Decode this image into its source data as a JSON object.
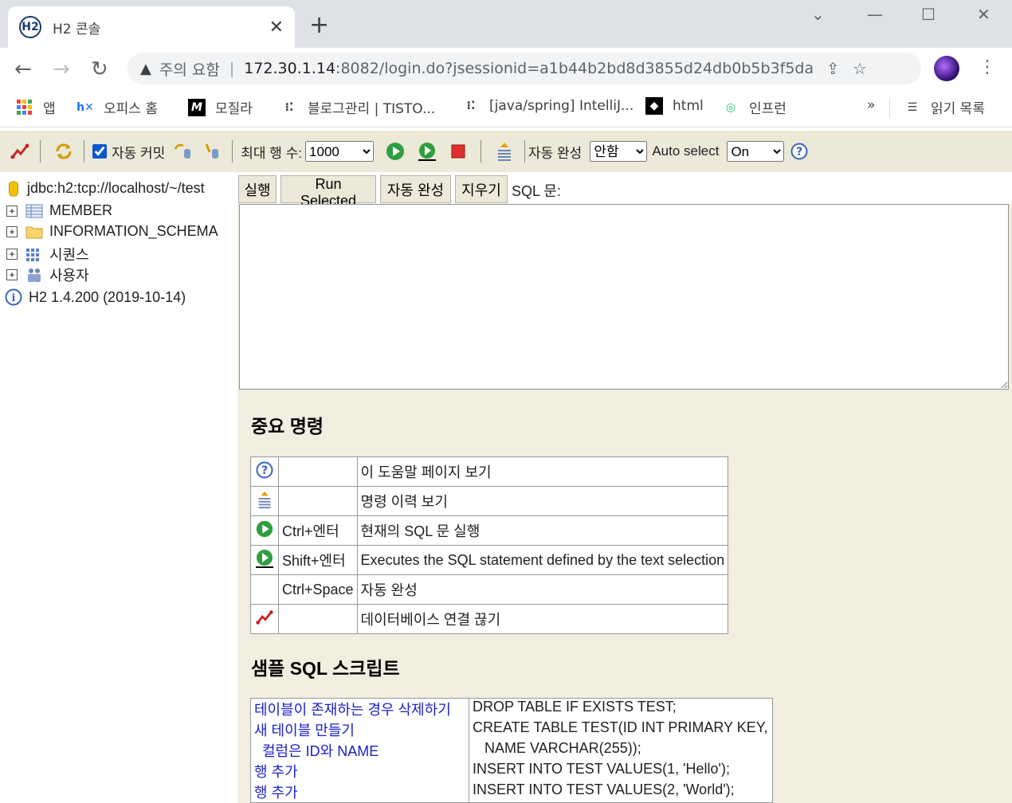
{
  "browser": {
    "tab_favicon": "H2",
    "tab_title": "H2 콘솔",
    "url_warning": "주의 요함",
    "url_host": "172.30.1.14",
    "url_path": ":8082/login.do?jsessionid=a1b44b2bd8d3855d24db0b5b3f5da...",
    "bookmarks": [
      {
        "label": "앱",
        "icon": "apps-grid-icon"
      },
      {
        "label": "오피스 홈",
        "icon": "office-hiworks-icon"
      },
      {
        "label": "모질라",
        "icon": "mozilla-icon"
      },
      {
        "label": "블로그관리 | TISTO...",
        "icon": "tistory-icon"
      },
      {
        "label": "[java/spring] IntelliJ...",
        "icon": "tistory-icon"
      },
      {
        "label": "html",
        "icon": "html-bird-icon"
      },
      {
        "label": "인프런",
        "icon": "inflearn-icon"
      }
    ],
    "bookmarks_more": "»",
    "reading_list": "읽기 목록"
  },
  "toolbar": {
    "auto_commit_label": "자동 커밋",
    "max_rows_label": "최대 행 수:",
    "max_rows_value": "1000",
    "auto_complete_label": "자동 완성",
    "auto_complete_value": "안함",
    "auto_select_label": "Auto select",
    "auto_select_value": "On"
  },
  "tree": {
    "connection": "jdbc:h2:tcp://localhost/~/test",
    "items": [
      {
        "label": "MEMBER",
        "icon": "table-icon"
      },
      {
        "label": "INFORMATION_SCHEMA",
        "icon": "folder-icon"
      },
      {
        "label": "시퀀스",
        "icon": "sequence-icon"
      },
      {
        "label": "사용자",
        "icon": "users-icon"
      }
    ],
    "version": "H2 1.4.200 (2019-10-14)"
  },
  "commands": {
    "run": "실행",
    "run_selected": "Run Selected",
    "auto_complete": "자동 완성",
    "clear": "지우기",
    "sql_label": "SQL 문:"
  },
  "important": {
    "title": "중요 명령",
    "rows": [
      {
        "icon": "help-icon",
        "key": "",
        "desc": "이 도움말 페이지 보기"
      },
      {
        "icon": "history-icon",
        "key": "",
        "desc": "명령 이력 보기"
      },
      {
        "icon": "run-icon",
        "key": "Ctrl+엔터",
        "desc": "현재의 SQL 문 실행"
      },
      {
        "icon": "run-selected-icon",
        "key": "Shift+엔터",
        "desc": "Executes the SQL statement defined by the text selection"
      },
      {
        "icon": "",
        "key": "Ctrl+Space",
        "desc": "자동 완성"
      },
      {
        "icon": "disconnect-icon",
        "key": "",
        "desc": "데이터베이스 연결 끊기"
      }
    ]
  },
  "sample": {
    "title": "샘플 SQL 스크립트",
    "rows": [
      {
        "label": "테이블이 존재하는 경우 삭제하기",
        "sql": "DROP TABLE IF EXISTS TEST;"
      },
      {
        "label": "새 테이블 만들기",
        "sql": "CREATE TABLE TEST(ID INT PRIMARY KEY,"
      },
      {
        "label": "컬럼은 ID와 NAME",
        "sql": "NAME VARCHAR(255));"
      },
      {
        "label": "행 추가",
        "sql": "INSERT INTO TEST VALUES(1, 'Hello');"
      },
      {
        "label": "행 추가",
        "sql": "INSERT INTO TEST VALUES(2, 'World');"
      }
    ]
  }
}
